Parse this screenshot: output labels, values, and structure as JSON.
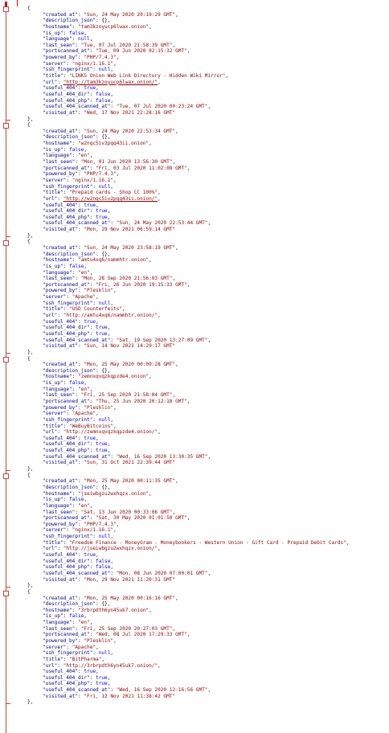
{
  "editor": {
    "records": [
      {
        "pairs": [
          [
            "created_at",
            "\"Sun, 24 May 2020 20:19:29 GMT\""
          ],
          [
            "description_json",
            "{}"
          ],
          [
            "hostname",
            "\"tam3kzoyucp6lwax.onion\""
          ],
          [
            "is_up",
            "false"
          ],
          [
            "language",
            "null"
          ],
          [
            "last_seen",
            "\"Tue, 07 Jul 2020 21:58:39 GMT\""
          ],
          [
            "portscanned_at",
            "\"Tue, 09 Jun 2020 02:15:32 GMT\""
          ],
          [
            "powered_by",
            "\"PHP/7.4.3\""
          ],
          [
            "server",
            "\"nginx/1.16.1\""
          ],
          [
            "ssh_fingerprint",
            "null"
          ],
          [
            "title",
            "\"LINKS Onion Web Link Directory - Hidden Wiki Mirror\""
          ],
          [
            "url",
            "\"http://tam3kzoyucp6lwax.onion/\""
          ],
          [
            "useful_404",
            "true"
          ],
          [
            "useful_404_dir",
            "false"
          ],
          [
            "useful_404_php",
            "false"
          ],
          [
            "useful_404_scanned_at",
            "\"Tue, 07 Jul 2020 00:23:24 GMT\""
          ],
          [
            "visited_at",
            "\"Wed, 17 Nov 2021 22:28:16 GMT\""
          ]
        ]
      },
      {
        "pairs": [
          [
            "created_at",
            "\"Sun, 24 May 2020 22:53:34 GMT\""
          ],
          [
            "description_json",
            "{}"
          ],
          [
            "hostname",
            "\"w2nqc5iv2pqq43ii.onion\""
          ],
          [
            "is_up",
            "false"
          ],
          [
            "language",
            "\"en\""
          ],
          [
            "last_seen",
            "\"Mon, 01 Jun 2020 13:56:30 GMT\""
          ],
          [
            "portscanned_at",
            "\"Fri, 03 Jul 2020 11:02:08 GMT\""
          ],
          [
            "powered_by",
            "\"PHP/7.4.3\""
          ],
          [
            "server",
            "\"nginx/1.16.1\""
          ],
          [
            "ssh_fingerprint",
            "null"
          ],
          [
            "title",
            "\"Prepaid cards - Shop CC 100%\""
          ],
          [
            "url",
            "\"http://w2nqc5iv2pqq43ii.onion/\""
          ],
          [
            "useful_404",
            "true"
          ],
          [
            "useful_404_dir",
            "true"
          ],
          [
            "useful_404_php",
            "true"
          ],
          [
            "useful_404_scanned_at",
            "\"Sun, 24 May 2020 22:53:44 GMT\""
          ],
          [
            "visited_at",
            "\"Mon, 29 Nov 2021 06:59:14 GMT\""
          ]
        ]
      },
      {
        "pairs": [
          [
            "created_at",
            "\"Sun, 24 May 2020 23:58:19 GMT\""
          ],
          [
            "description_json",
            "{}"
          ],
          [
            "hostname",
            "\"amtu4xq6/nammhtr.onion\""
          ],
          [
            "is_up",
            "false"
          ],
          [
            "language",
            "\"en\""
          ],
          [
            "last_seen",
            "\"Mon, 28 Sep 2020 21:56:03 GMT\""
          ],
          [
            "portscanned_at",
            "\"Fri, 26 Jun 2020 19:15:33 GMT\""
          ],
          [
            "powered_by",
            "\"Plesklin\""
          ],
          [
            "server",
            "\"Apache\""
          ],
          [
            "ssh_fingerprint",
            "null"
          ],
          [
            "title",
            "\"USD Counterfeits\""
          ],
          [
            "url",
            "\"http://amtu4xq6/nammhtr.onion/\""
          ],
          [
            "useful_404",
            "true"
          ],
          [
            "useful_404_dir",
            "true"
          ],
          [
            "useful_404_php",
            "true"
          ],
          [
            "useful_404_scanned_at",
            "\"Sat, 19 Sep 2020 13:27:09 GMT\""
          ],
          [
            "visited_at",
            "\"Sun, 14 Nov 2021 14:29:17 GMT\""
          ]
        ]
      },
      {
        "pairs": [
          [
            "created_at",
            "\"Mon, 25 May 2020 00:09:28 GMT\""
          ],
          [
            "description_json",
            "{}"
          ],
          [
            "hostname",
            "\"zemnxqvqzkqpzde4.onion\""
          ],
          [
            "is_up",
            "false"
          ],
          [
            "language",
            "\"en\""
          ],
          [
            "last_seen",
            "\"Fri, 25 Sep 2020 21:58:04 GMT\""
          ],
          [
            "portscanned_at",
            "\"Thu, 25 Jun 2020 20:12:18 GMT\""
          ],
          [
            "powered_by",
            "\"Plesklin\""
          ],
          [
            "server",
            "\"Apache\""
          ],
          [
            "ssh_fingerprint",
            "null"
          ],
          [
            "title",
            "\"WeBuyBitcoins\""
          ],
          [
            "url",
            "\"http://zemnxqvqzkqpzde4.onion/\""
          ],
          [
            "useful_404",
            "true"
          ],
          [
            "useful_404_dir",
            "true"
          ],
          [
            "useful_404_php",
            "true"
          ],
          [
            "useful_404_scanned_at",
            "\"Wed, 16 Sep 2020 13:30:35 GMT\""
          ],
          [
            "visited_at",
            "\"Sun, 31 Oct 2021 22:39:44 GMT\""
          ]
        ]
      },
      {
        "pairs": [
          [
            "created_at",
            "\"Mon, 25 May 2020 00:11:35 GMT\""
          ],
          [
            "description_json",
            "{}"
          ],
          [
            "hostname",
            "\"jseiwbgzu2wxhqzx.onion\""
          ],
          [
            "is_up",
            "false"
          ],
          [
            "language",
            "\"en\""
          ],
          [
            "last_seen",
            "\"Sat, 13 Jun 2020 00:33:06 GMT\""
          ],
          [
            "portscanned_at",
            "\"Sat, 30 May 2020 01:01:50 GMT\""
          ],
          [
            "powered_by",
            "\"PHP/7.4.3\""
          ],
          [
            "server",
            "\"nginx/1.16.1\""
          ],
          [
            "ssh_fingerprint",
            "null"
          ],
          [
            "title",
            "\"Freedom Finance - MoneyGram - Moneybookers - Western Union - Gift Card - Prepaid Debit Cards\""
          ],
          [
            "url",
            "\"http://jseiwbgzu2wxhqzx.onion/\""
          ],
          [
            "useful_404",
            "true"
          ],
          [
            "useful_404_dir",
            "false"
          ],
          [
            "useful_404_php",
            "false"
          ],
          [
            "useful_404_scanned_at",
            "\"Mon, 08 Jun 2020 07:00:01 GMT\""
          ],
          [
            "visited_at",
            "\"Mon, 29 Nov 2021 11:20:31 GMT\""
          ]
        ]
      },
      {
        "pairs": [
          [
            "created_at",
            "\"Mon, 25 May 2020 00:16:16 GMT\""
          ],
          [
            "description_json",
            "{}"
          ],
          [
            "hostname",
            "\"3rbrpdth6yn45uk7.onion\""
          ],
          [
            "is_up",
            "false"
          ],
          [
            "language",
            "\"en\""
          ],
          [
            "last_seen",
            "\"Fri, 25 Sep 2020 20:27:03 GMT\""
          ],
          [
            "portscanned_at",
            "\"Wed, 08 Jul 2020 17:29:33 GMT\""
          ],
          [
            "powered_by",
            "\"Plesklin\""
          ],
          [
            "server",
            "\"Apache\""
          ],
          [
            "ssh_fingerprint",
            "null"
          ],
          [
            "title",
            "\"BitPharma\""
          ],
          [
            "url",
            "\"http://3rbrpdth6yn45uk7.onion/\""
          ],
          [
            "useful_404",
            "true"
          ],
          [
            "useful_404_dir",
            "true"
          ],
          [
            "useful_404_php",
            "true"
          ],
          [
            "useful_404_scanned_at",
            "\"Wed, 16 Sep 2020 12:16:56 GMT\""
          ],
          [
            "visited_at",
            "\"Fri, 12 Nov 2021 11:38:42 GMT\""
          ]
        ]
      }
    ]
  }
}
